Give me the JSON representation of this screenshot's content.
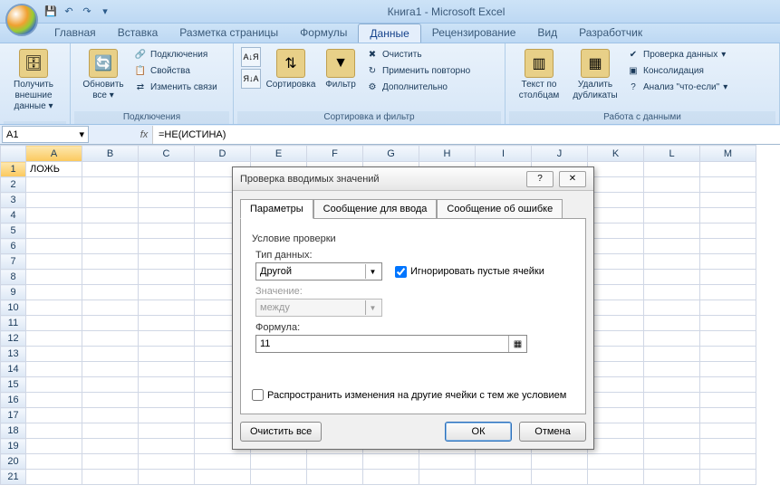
{
  "app": {
    "title": "Книга1  -  Microsoft Excel"
  },
  "qat": {
    "save": "💾",
    "undo": "↶",
    "redo": "↷",
    "more": "▾"
  },
  "tabs": [
    "Главная",
    "Вставка",
    "Разметка страницы",
    "Формулы",
    "Данные",
    "Рецензирование",
    "Вид",
    "Разработчик"
  ],
  "activeTab": 4,
  "ribbon": {
    "g1": {
      "label": "",
      "btn": "Получить внешние данные",
      "arrow": "▾"
    },
    "g2": {
      "label": "Подключения",
      "refresh": "Обновить все",
      "arrow": "▾",
      "items": [
        "Подключения",
        "Свойства",
        "Изменить связи"
      ]
    },
    "g3": {
      "label": "Сортировка и фильтр",
      "az": "А↓Я",
      "za": "Я↓А",
      "sort": "Сортировка",
      "filter": "Фильтр",
      "clear": "Очистить",
      "reapply": "Применить повторно",
      "adv": "Дополнительно"
    },
    "g4": {
      "label": "Работа с данными",
      "cols": "Текст по столбцам",
      "dups": "Удалить дубликаты",
      "validate": "Проверка данных",
      "arrow": "▾",
      "consol": "Консолидация",
      "whatif": "Анализ \"что-если\"",
      "arrow2": "▾"
    }
  },
  "namebox": {
    "value": "A1",
    "arrow": "▾"
  },
  "fx": "fx",
  "formula": "=НЕ(ИСТИНА)",
  "columns": [
    "A",
    "B",
    "C",
    "D",
    "E",
    "F",
    "G",
    "H",
    "I",
    "J",
    "K",
    "L",
    "M"
  ],
  "rows": [
    1,
    2,
    3,
    4,
    5,
    6,
    7,
    8,
    9,
    10,
    11,
    12,
    13,
    14,
    15,
    16,
    17,
    18,
    19,
    20,
    21
  ],
  "cellA1": "ЛОЖЬ",
  "dialog": {
    "title": "Проверка вводимых значений",
    "help": "?",
    "close": "✕",
    "tab1": "Параметры",
    "tab2": "Сообщение для ввода",
    "tab3": "Сообщение об ошибке",
    "section": "Условие проверки",
    "type_label": "Тип данных:",
    "type_value": "Другой",
    "ignore": "Игнорировать пустые ячейки",
    "value_label": "Значение:",
    "value_value": "между",
    "formula_label": "Формула:",
    "formula_value": "11",
    "propagate": "Распространить изменения на другие ячейки с тем же условием",
    "clear": "Очистить все",
    "ok": "ОК",
    "cancel": "Отмена",
    "combo_arrow": "▼"
  }
}
